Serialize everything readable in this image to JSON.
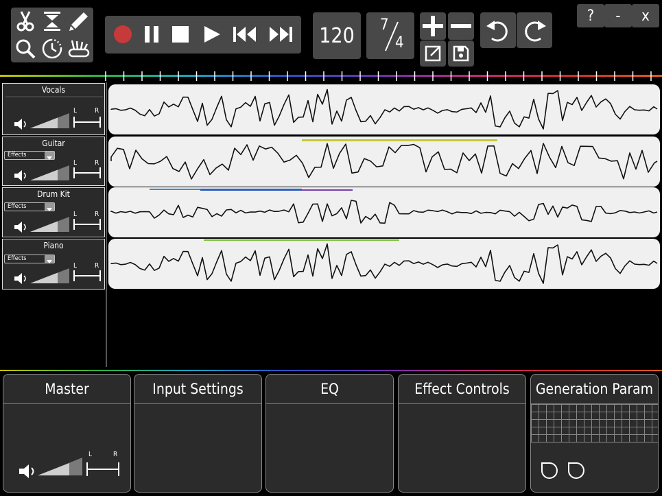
{
  "toolbar": {
    "tools": [
      {
        "name": "scissors-icon"
      },
      {
        "name": "split-icon"
      },
      {
        "name": "pencil-icon"
      },
      {
        "name": "zoom-icon"
      },
      {
        "name": "timer-icon"
      },
      {
        "name": "multitool-icon"
      }
    ],
    "transport": [
      "record-icon",
      "pause-icon",
      "stop-icon",
      "play-icon",
      "skip-back-icon",
      "skip-forward-icon"
    ],
    "tempo": "120",
    "time_signature": {
      "top": "7",
      "bottom": "4"
    },
    "window": {
      "help": "?",
      "minimize": "-",
      "close": "x"
    }
  },
  "tracks": [
    {
      "name": "Vocals",
      "effects": null
    },
    {
      "name": "Guitar",
      "effects": "Effects"
    },
    {
      "name": "Drum Kit",
      "effects": "Effects"
    },
    {
      "name": "Piano",
      "effects": "Effects"
    }
  ],
  "pan_labels": {
    "left": "L",
    "right": "R"
  },
  "panels": {
    "master": "Master",
    "input": "Input Settings",
    "eq": "EQ",
    "effects": "Effect Controls",
    "generation": "Generation Param"
  },
  "colors": {
    "panel_bg": "#2b2b2b",
    "button_bg": "#484848",
    "record": "#c73a3a",
    "lane_bg": "#f0f0f0",
    "marker_guitar": "#c8c832",
    "marker_drum_1": "#2c8fd6",
    "marker_drum_2": "#2f5fc0",
    "marker_drum_3": "#7a3fb0",
    "marker_piano": "#7cc23a"
  }
}
